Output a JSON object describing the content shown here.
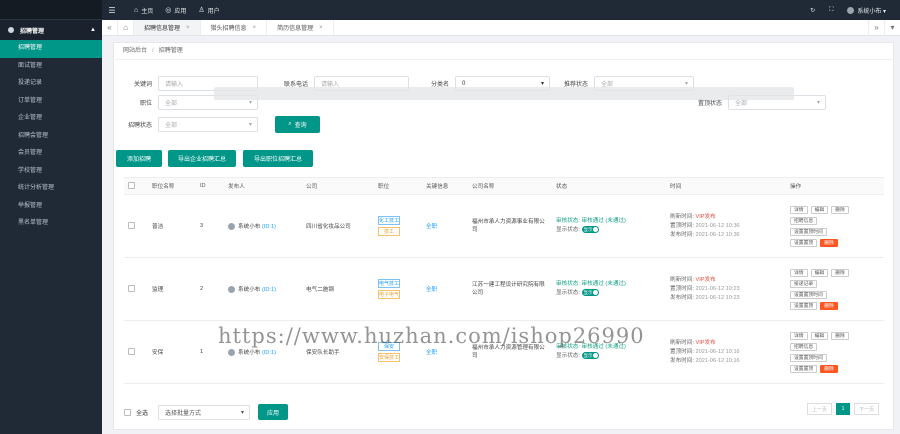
{
  "topbar": {
    "links": [
      {
        "icon": "⌂",
        "label": "主页"
      },
      {
        "icon": "◎",
        "label": "应用"
      },
      {
        "icon": "♙",
        "label": "用户"
      }
    ],
    "user": "系统小布 ▾"
  },
  "sidebar": {
    "group": "招聘管理",
    "items": [
      "招聘管理",
      "面试管理",
      "投递记录",
      "订单管理",
      "企业管理",
      "招聘会管理",
      "会员管理",
      "学校管理",
      "统计分析管理",
      "举报管理",
      "黑名单管理"
    ]
  },
  "tabs": [
    {
      "label": "招聘信息管理",
      "active": true
    },
    {
      "label": "猎头招聘信息",
      "active": false
    },
    {
      "label": "简历信息管理",
      "active": false
    }
  ],
  "breadcrumb": {
    "home": "网站后台",
    "current": "招聘管理"
  },
  "filters": {
    "keyword": {
      "label": "关键词",
      "placeholder": "请输入"
    },
    "contact": {
      "label": "联系电话",
      "placeholder": "请输入"
    },
    "category": {
      "label": "分类名",
      "value": "0"
    },
    "rec_status": {
      "label": "推荐状态",
      "placeholder": "全部"
    },
    "position": {
      "label": "职位",
      "placeholder": "全部"
    },
    "top_status": {
      "label": "置顶状态",
      "placeholder": "全部"
    },
    "recruit_status": {
      "label": "招聘状态",
      "placeholder": "全部"
    },
    "search_label": "查询"
  },
  "toolbar": {
    "add": "添加招聘",
    "export_company": "导出企业招聘汇总",
    "export_position": "导出职位招聘汇总"
  },
  "table": {
    "headers": [
      "",
      "职位名称",
      "ID",
      "发布人",
      "公司",
      "职位",
      "关键信息",
      "公司名称",
      "状态",
      "时间",
      "操作"
    ],
    "rows": [
      {
        "title": "普洁",
        "id": "3",
        "publisher": "系统小布",
        "pub_tag": "(ID:1)",
        "company": "四川省化妆品公司",
        "tags": [
          "化工技工",
          "技工"
        ],
        "key": "全职",
        "company_name": "福州市承人力资源事业有限公司",
        "audit": "审核状态: 审核通过 (未通过)",
        "show": "显示状态:",
        "toggle": "显示",
        "time_label_top": "VIP发布",
        "t1": "2021-06-12 10:36",
        "t2": "2021-06-12 10:36",
        "t3": "2021-06-12 10:36",
        "ops": [
          "详情",
          "编辑",
          "删除",
          "招聘信息",
          "设置置顶时间",
          "设置置顶"
        ],
        "danger": "删除"
      },
      {
        "title": "监理",
        "id": "2",
        "publisher": "系统小布",
        "pub_tag": "(ID:1)",
        "company": "电气二施钢",
        "tags": [
          "电气技工",
          "电子电气"
        ],
        "key": "全职",
        "company_name": "江苏一建工程设计研究院有限公司",
        "audit": "审核状态: 审核通过 (未通过)",
        "show": "显示状态:",
        "toggle": "显示",
        "time_label_top": "VIP发布",
        "t1": "2021-06-12 10:23",
        "t2": "2021-06-12 10:23",
        "t3": "2021-06-12 10:23",
        "ops": [
          "详情",
          "编辑",
          "删除",
          "投递记录",
          "设置置顶时间",
          "设置置顶"
        ],
        "danger": "删除"
      },
      {
        "title": "安保",
        "id": "1",
        "publisher": "系统小布",
        "pub_tag": "(ID:1)",
        "company": "保安队长助手",
        "tags": [
          "保安",
          "安保技工"
        ],
        "key": "全职",
        "company_name": "福州市承人力资源管理有限公司",
        "audit": "审核状态: 审核通过 (未通过)",
        "show": "显示状态:",
        "toggle": "显示",
        "time_label_top": "VIP发布",
        "t1": "2021-06-12 10:16",
        "t2": "2021-06-12 10:16",
        "t3": "2021-06-12 10:16",
        "ops": [
          "详情",
          "编辑",
          "删除",
          "招聘信息",
          "设置置顶时间",
          "设置置顶"
        ],
        "danger": "删除"
      }
    ],
    "time_keys": [
      "刷新时间:",
      "置顶时间:",
      "发布时间:"
    ]
  },
  "footer": {
    "select_all": "全选",
    "batch_placeholder": "选择批量方式",
    "apply": "应用"
  },
  "pager": {
    "prev": "上一页",
    "current": "1",
    "next": "下一页"
  },
  "watermark": "https://www.huzhan.com/ishop26990",
  "colors": {
    "accent": "#009688",
    "sidebar": "#1f2a36",
    "link": "#1e9fff",
    "danger": "#ff5722"
  }
}
